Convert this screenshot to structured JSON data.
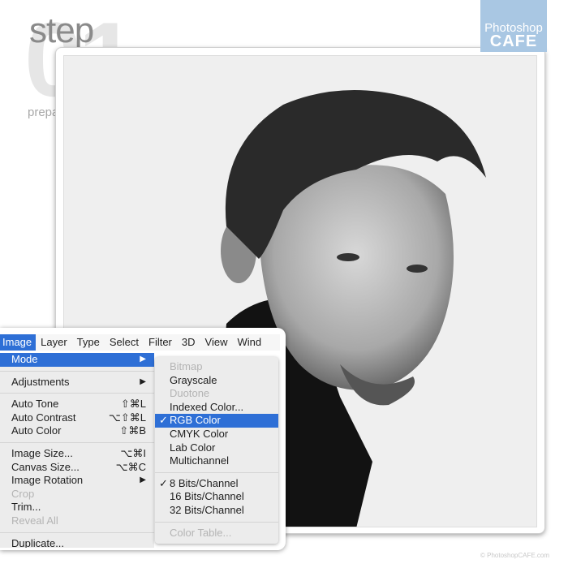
{
  "header": {
    "big_number": "01",
    "step_label": "step",
    "subtitle": "prepare the file"
  },
  "logo": {
    "line1": "Photoshop",
    "line2": "CAFE",
    "color": "#a9c7e3"
  },
  "footer": {
    "copyright": "© PhotoshopCAFE.com"
  },
  "menubar": {
    "items": [
      "Image",
      "Layer",
      "Type",
      "Select",
      "Filter",
      "3D",
      "View",
      "Wind"
    ],
    "active": "Image"
  },
  "image_menu": {
    "items": [
      {
        "label": "Mode",
        "submenu": true,
        "highlighted": true
      },
      {
        "sep": true
      },
      {
        "label": "Adjustments",
        "submenu": true
      },
      {
        "sep": true
      },
      {
        "label": "Auto Tone",
        "shortcut": "⇧⌘L"
      },
      {
        "label": "Auto Contrast",
        "shortcut": "⌥⇧⌘L"
      },
      {
        "label": "Auto Color",
        "shortcut": "⇧⌘B"
      },
      {
        "sep": true
      },
      {
        "label": "Image Size...",
        "shortcut": "⌥⌘I"
      },
      {
        "label": "Canvas Size...",
        "shortcut": "⌥⌘C"
      },
      {
        "label": "Image Rotation",
        "submenu": true
      },
      {
        "label": "Crop",
        "disabled": true
      },
      {
        "label": "Trim..."
      },
      {
        "label": "Reveal All",
        "disabled": true
      },
      {
        "sep": true
      },
      {
        "label": "Duplicate..."
      }
    ]
  },
  "mode_submenu": {
    "items": [
      {
        "label": "Bitmap",
        "disabled": true
      },
      {
        "label": "Grayscale"
      },
      {
        "label": "Duotone",
        "disabled": true
      },
      {
        "label": "Indexed Color..."
      },
      {
        "label": "RGB Color",
        "checked": true,
        "highlighted": true
      },
      {
        "label": "CMYK Color"
      },
      {
        "label": "Lab Color"
      },
      {
        "label": "Multichannel"
      },
      {
        "sep": true
      },
      {
        "label": "8 Bits/Channel",
        "checked": true
      },
      {
        "label": "16 Bits/Channel"
      },
      {
        "label": "32 Bits/Channel"
      },
      {
        "sep": true
      },
      {
        "label": "Color Table...",
        "disabled": true
      }
    ]
  },
  "colors": {
    "highlight": "#2e6fd6",
    "menu_bg": "#ececec"
  }
}
